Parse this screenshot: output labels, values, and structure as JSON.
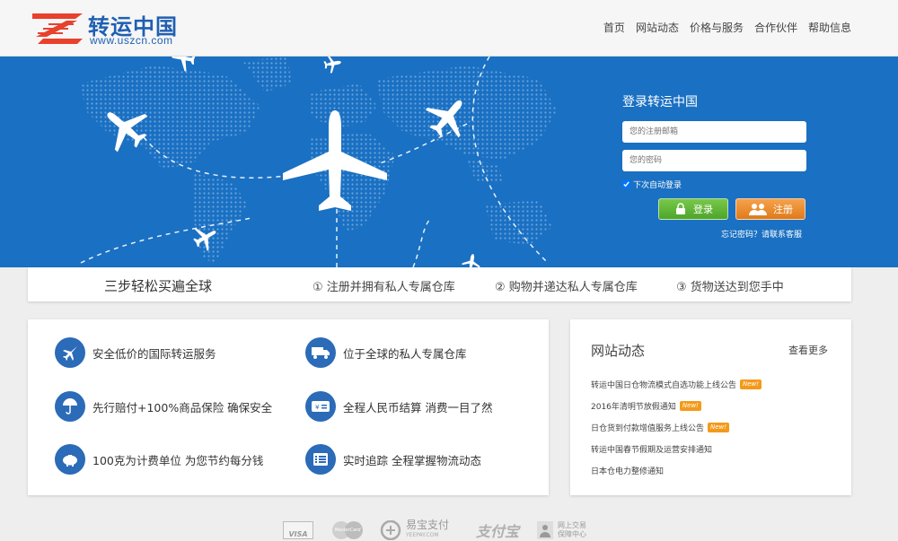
{
  "header": {
    "logo_title": "转运中国",
    "logo_url": "www.uszcn.com",
    "nav": [
      "首页",
      "网站动态",
      "价格与服务",
      "合作伙伴",
      "帮助信息"
    ]
  },
  "login": {
    "title": "登录转运中国",
    "email_placeholder": "您的注册邮箱",
    "password_placeholder": "您的密码",
    "remember_label": "下次自动登录",
    "login_button": "登录",
    "register_button": "注册",
    "forgot_text": "忘记密码？请联系客服"
  },
  "steps": {
    "title": "三步轻松买遍全球",
    "items": [
      "① 注册并拥有私人专属仓库",
      "② 购物并递达私人专属仓库",
      "③ 货物送达到您手中"
    ]
  },
  "features": [
    {
      "icon": "airplane-icon",
      "text": "安全低价的国际转运服务"
    },
    {
      "icon": "truck-icon",
      "text": "位于全球的私人专属仓库"
    },
    {
      "icon": "umbrella-icon",
      "text": "先行赔付+100%商品保险  确保安全"
    },
    {
      "icon": "rmb-card-icon",
      "text": "全程人民币结算  消费一目了然"
    },
    {
      "icon": "piggy-bank-icon",
      "text": "100克为计费单位  为您节约每分钱"
    },
    {
      "icon": "list-icon",
      "text": "实时追踪  全程掌握物流动态"
    }
  ],
  "news": {
    "title": "网站动态",
    "more": "查看更多",
    "items": [
      {
        "text": "转运中国日仓物流模式自选功能上线公告",
        "badge": "New!"
      },
      {
        "text": "2016年清明节放假通知",
        "badge": "New!"
      },
      {
        "text": "日仓货到付款增值服务上线公告",
        "badge": "New!"
      },
      {
        "text": "转运中国春节假期及运营安排通知",
        "badge": ""
      },
      {
        "text": "日本仓电力整修通知",
        "badge": ""
      }
    ]
  },
  "footer": {
    "visa": "VISA",
    "mastercard": "MasterCard",
    "yeepay": "易宝支付",
    "yeepay_url": "YEEPAY.COM",
    "alipay": "支付宝",
    "alipay_guard": "网上交易",
    "alipay_guard2": "保障中心"
  },
  "colors": {
    "banner": "#1a70c2",
    "accent": "#2b6bb8",
    "login_btn": "#5cb335",
    "register_btn": "#ee8a2a",
    "badge": "#f39a1b"
  }
}
